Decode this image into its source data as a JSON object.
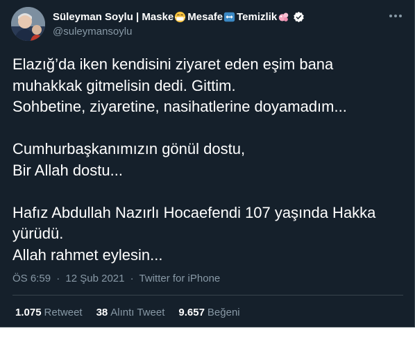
{
  "author": {
    "name_part1": "Süleyman Soylu | Maske",
    "name_part2": "Mesafe",
    "name_part3": "Temizlik",
    "handle": "@suleymansoylu",
    "avatar_icon": "profile-photo",
    "verified_color": "#ffffff"
  },
  "tweet": {
    "lines": [
      "Elazığ’da iken kendisini ziyaret eden eşim bana",
      "muhakkak gitmelisin dedi. Gittim.",
      "Sohbetine, ziyaretine, nasihatlerine doyamadım...",
      "",
      "Cumhurbaşkanımızın gönül dostu,",
      "Bir Allah dostu...",
      "",
      "Hafız Abdullah Nazırlı Hocaefendi 107 yaşında Hakka",
      "yürüdü.",
      "Allah rahmet eylesin..."
    ],
    "time": "ÖS 6:59",
    "separator": "·",
    "date": "12 Şub 2021",
    "source": "Twitter for iPhone"
  },
  "stats": {
    "retweets": "1.075",
    "retweets_label": "Retweet",
    "quotes": "38",
    "quotes_label": "Alıntı Tweet",
    "likes": "9.657",
    "likes_label": "Beğeni"
  },
  "colors": {
    "background": "#15202b",
    "text": "#ffffff",
    "secondary": "#8899a6",
    "border": "#38444d"
  }
}
